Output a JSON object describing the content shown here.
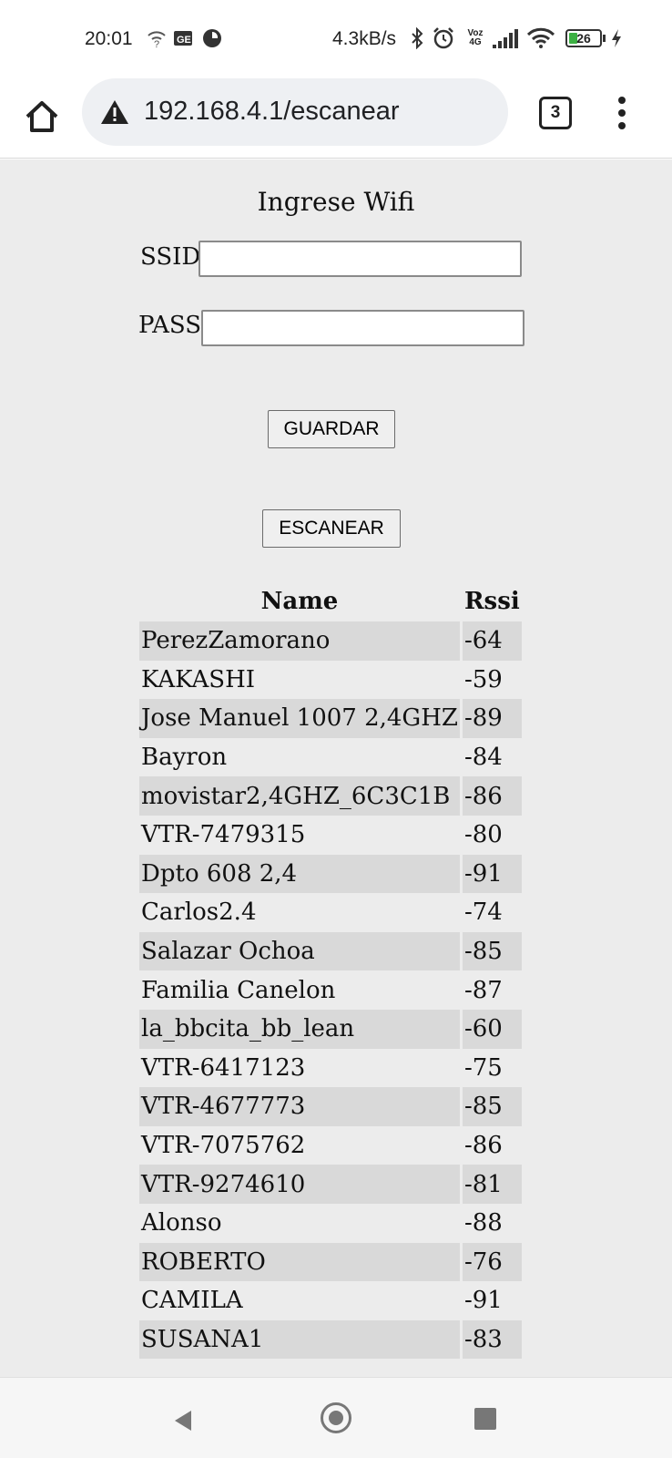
{
  "status_bar": {
    "time": "20:01",
    "net_speed": "4.3kB/s",
    "volte_line1": "Voz",
    "volte_line2": "4G",
    "battery": "26",
    "icons": [
      "wifi-question-icon",
      "sim-card-icon",
      "app-notification-icon",
      "bluetooth-icon",
      "alarm-icon",
      "volte-icon",
      "signal-icon",
      "wifi-icon",
      "battery-icon",
      "charging-icon"
    ]
  },
  "browser": {
    "url": "192.168.4.1/escanear",
    "tab_count": "3",
    "icons": [
      "home-icon",
      "warning-icon",
      "tabs-icon",
      "more-vert-icon"
    ]
  },
  "form": {
    "title": "Ingrese Wifi",
    "ssid_label": "SSID",
    "ssid_value": "",
    "pass_label": "PASS",
    "pass_value": "",
    "save_button": "GUARDAR",
    "scan_button": "ESCANEAR"
  },
  "networks": {
    "headers": [
      "Name",
      "Rssi"
    ],
    "rows": [
      {
        "name": "PerezZamorano",
        "rssi": "-64"
      },
      {
        "name": "KAKASHI",
        "rssi": "-59"
      },
      {
        "name": "Jose Manuel 1007 2,4GHZ",
        "rssi": "-89"
      },
      {
        "name": "Bayron",
        "rssi": "-84"
      },
      {
        "name": "movistar2,4GHZ_6C3C1B",
        "rssi": "-86"
      },
      {
        "name": "VTR-7479315",
        "rssi": "-80"
      },
      {
        "name": "Dpto 608 2,4",
        "rssi": "-91"
      },
      {
        "name": "Carlos2.4",
        "rssi": "-74"
      },
      {
        "name": "Salazar Ochoa",
        "rssi": "-85"
      },
      {
        "name": "Familia Canelon",
        "rssi": "-87"
      },
      {
        "name": "la_bbcita_bb_lean",
        "rssi": "-60"
      },
      {
        "name": "VTR-6417123",
        "rssi": "-75"
      },
      {
        "name": "VTR-4677773",
        "rssi": "-85"
      },
      {
        "name": "VTR-7075762",
        "rssi": "-86"
      },
      {
        "name": "VTR-9274610",
        "rssi": "-81"
      },
      {
        "name": "Alonso",
        "rssi": "-88"
      },
      {
        "name": "ROBERTO",
        "rssi": "-76"
      },
      {
        "name": "CAMILA",
        "rssi": "-91"
      },
      {
        "name": "SUSANA1",
        "rssi": "-83"
      }
    ]
  },
  "nav_bar": {
    "icons": [
      "back-icon",
      "home-circle-icon",
      "recents-icon"
    ]
  }
}
